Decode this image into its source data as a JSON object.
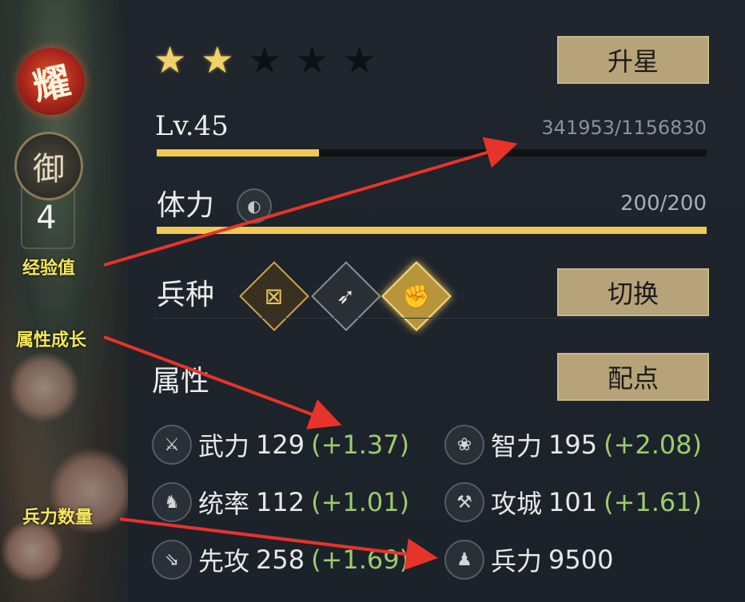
{
  "badges": {
    "yao": "耀",
    "yu": "御",
    "yu_level": "4"
  },
  "stars": {
    "filled": 2,
    "total": 5
  },
  "buttons": {
    "upgrade_star": "升星",
    "switch": "切换",
    "allocate": "配点"
  },
  "level": {
    "label": "Lv.45",
    "exp_text": "341953/1156830",
    "exp_fraction": 0.2956
  },
  "stamina": {
    "label": "体力",
    "value_text": "200/200",
    "fraction": 1.0
  },
  "troop_type": {
    "label": "兵种",
    "icons": [
      "sword-troop-icon",
      "bow-troop-icon",
      "fist-troop-icon"
    ]
  },
  "attributes": {
    "title": "属性",
    "items": [
      {
        "name": "武力",
        "value": "129",
        "growth": "(+1.37)",
        "icon": "crossed-swords-icon"
      },
      {
        "name": "智力",
        "value": "195",
        "growth": "(+2.08)",
        "icon": "lotus-icon"
      },
      {
        "name": "统率",
        "value": "112",
        "growth": "(+1.01)",
        "icon": "dragon-icon"
      },
      {
        "name": "攻城",
        "value": "101",
        "growth": "(+1.61)",
        "icon": "catapult-icon"
      },
      {
        "name": "先攻",
        "value": "258",
        "growth": "(+1.69)",
        "icon": "arrow-speed-icon"
      },
      {
        "name": "兵力",
        "value": "9500",
        "growth": "",
        "icon": "soldier-icon"
      }
    ]
  },
  "annotations": {
    "exp": "经验值",
    "growth": "属性成长",
    "troops": "兵力数量"
  },
  "colors": {
    "accent_gold": "#f2c957",
    "button_bg": "#b6a37a",
    "growth_green": "#9ccb6e",
    "annotation_yellow": "#f6e65a",
    "arrow_red": "#e8332a"
  }
}
